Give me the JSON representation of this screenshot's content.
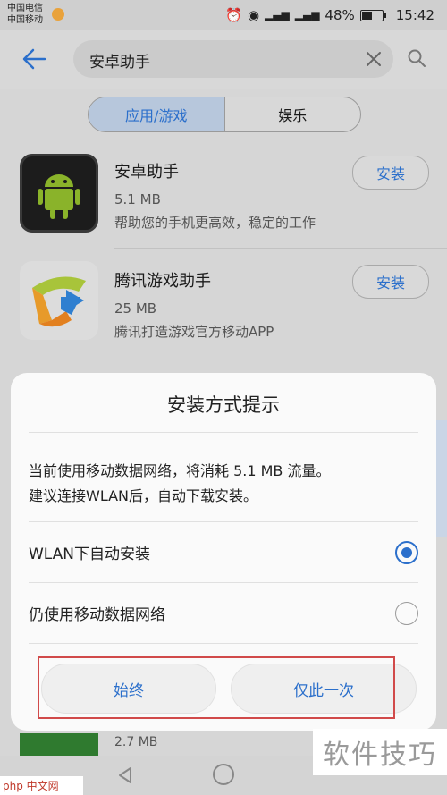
{
  "status_bar": {
    "carrier_1": "中国电信",
    "carrier_2": "中国移动",
    "battery": "48%",
    "time": "15:42"
  },
  "app_bar": {
    "search_value": "安卓助手"
  },
  "tabs": [
    {
      "label": "应用/游戏",
      "active": true
    },
    {
      "label": "娱乐",
      "active": false
    }
  ],
  "apps": [
    {
      "name": "安卓助手",
      "size": "5.1 MB",
      "desc": "帮助您的手机更高效，稳定的工作",
      "action": "安装"
    },
    {
      "name": "腾讯游戏助手",
      "size": "25 MB",
      "desc": "腾讯打造游戏官方移动APP",
      "action": "安装"
    }
  ],
  "partial_row": {
    "size": "2.7 MB"
  },
  "dialog": {
    "title": "安装方式提示",
    "message_line_1": "当前使用移动数据网络，将消耗 5.1 MB 流量。",
    "message_line_2": "建议连接WLAN后，自动下载安装。",
    "options": [
      {
        "label": "WLAN下自动安装",
        "selected": true
      },
      {
        "label": "仍使用移动数据网络",
        "selected": false
      }
    ],
    "buttons": {
      "always": "始终",
      "once": "仅此一次"
    }
  },
  "watermarks": {
    "right": "软件技巧",
    "left": "php 中文网"
  },
  "colors": {
    "accent": "#2b6fcb",
    "highlight_box": "#d14a4a"
  }
}
